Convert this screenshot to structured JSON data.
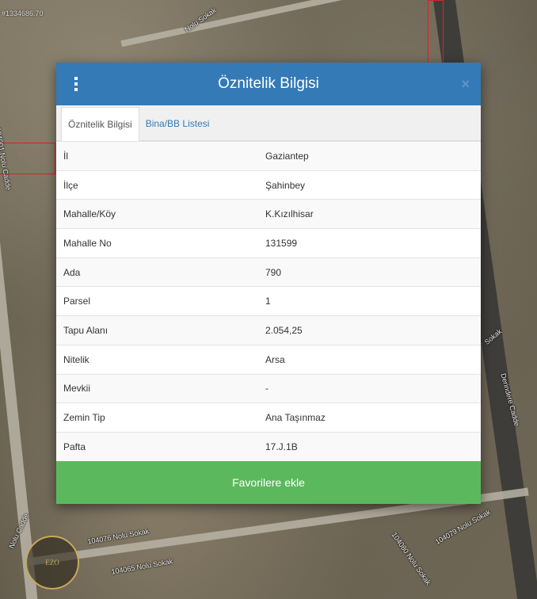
{
  "map": {
    "coordinate": "#1334686.70",
    "road_labels": [
      "104001 Nolu Cadde",
      "Nolu Sokak",
      "Derindere Cadde",
      "Sokak",
      "104065 Nolu Sokak",
      "104076 Nolu Sokak",
      "104079 Nolu Sokak",
      "104080 Nolu Sokak",
      "Nolu Cadde"
    ],
    "logo_text": "EZO"
  },
  "modal": {
    "title": "Öznitelik Bilgisi",
    "close_label": "×",
    "tabs": [
      {
        "label": "Öznitelik Bilgisi",
        "active": true
      },
      {
        "label": "Bina/BB Listesi",
        "active": false
      }
    ],
    "rows": [
      {
        "key": "İl",
        "value": "Gaziantep"
      },
      {
        "key": "İlçe",
        "value": "Şahinbey"
      },
      {
        "key": "Mahalle/Köy",
        "value": "K.Kızılhisar"
      },
      {
        "key": "Mahalle No",
        "value": "131599"
      },
      {
        "key": "Ada",
        "value": "790"
      },
      {
        "key": "Parsel",
        "value": "1"
      },
      {
        "key": "Tapu Alanı",
        "value": "2.054,25"
      },
      {
        "key": "Nitelik",
        "value": "Arsa"
      },
      {
        "key": "Mevkii",
        "value": "-"
      },
      {
        "key": "Zemin Tip",
        "value": "Ana Taşınmaz"
      },
      {
        "key": "Pafta",
        "value": "17.J.1B"
      }
    ],
    "favorite_button": "Favorilere ekle"
  },
  "colors": {
    "header": "#337ab7",
    "button": "#5cb85c",
    "link": "#337ab7"
  }
}
